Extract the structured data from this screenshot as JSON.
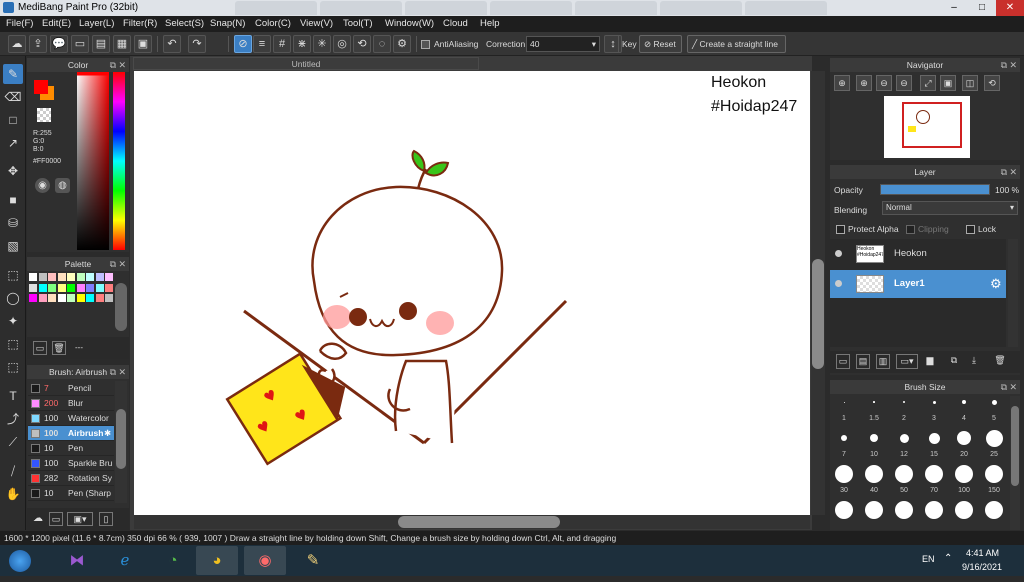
{
  "window": {
    "title": "MediBang Paint Pro (32bit)",
    "minimize": "–",
    "maximize": "□",
    "close": "✕"
  },
  "menu": [
    "File(F)",
    "Edit(E)",
    "Layer(L)",
    "Filter(R)",
    "Select(S)",
    "Snap(N)",
    "Color(C)",
    "View(V)",
    "Tool(T)",
    "Window(W)",
    "Cloud",
    "Help"
  ],
  "toolbar": {
    "antialiasing_label": "AntiAliasing",
    "correction_label": "Correction",
    "correction_value": "40",
    "key_label": "Key",
    "reset_label": "Reset",
    "straight_line_label": "Create a straight line"
  },
  "color_panel": {
    "title": "Color",
    "r_label": "R:255",
    "g_label": "G:0",
    "b_label": "B:0",
    "hex": "#FF0000",
    "foreground": "#ff0000",
    "background": "#ff8c00"
  },
  "palette_panel": {
    "title": "Palette",
    "colors": [
      "#ffffff",
      "#bfbfbf",
      "#ffbfbf",
      "#ffe0bf",
      "#ffffbf",
      "#bfffbf",
      "#bfffff",
      "#bfbfff",
      "#ffbfff",
      "#dfdfdf",
      "#00ffff",
      "#7fff7f",
      "#ffff7f",
      "#00ff00",
      "#ff7fff",
      "#7f7fff",
      "#7fffff",
      "#ff7f7f",
      "#ff00ff",
      "#ff9fbf",
      "#ffdfbf",
      "#ffffff",
      "#bfffbf",
      "#ffff00",
      "#00ffff",
      "#ff7f7f",
      "#bfbfbf"
    ],
    "dash": "---"
  },
  "brush_panel": {
    "title": "Brush: Airbrush",
    "items": [
      {
        "size": "7",
        "name": "Pencil",
        "color": "#1a1a1a"
      },
      {
        "size": "200",
        "name": "Blur",
        "color": "#ff8cff"
      },
      {
        "size": "100",
        "name": "Watercolor",
        "color": "#7fd9ff"
      },
      {
        "size": "100",
        "name": "Airbrush",
        "color": "#bfbfbf"
      },
      {
        "size": "10",
        "name": "Pen",
        "color": "#1a1a1a"
      },
      {
        "size": "100",
        "name": "Sparkle Bru",
        "color": "#3355ff"
      },
      {
        "size": "282",
        "name": "Rotation Sy",
        "color": "#ff3333"
      },
      {
        "size": "10",
        "name": "Pen (Sharp",
        "color": "#1a1a1a"
      }
    ],
    "selected_index": 3
  },
  "document": {
    "tab_title": "Untitled",
    "watermark_line1": "Heokon",
    "watermark_line2": "#Hoidap247"
  },
  "navigator": {
    "title": "Navigator"
  },
  "layer_panel": {
    "title": "Layer",
    "opacity_label": "Opacity",
    "opacity_value": "100 %",
    "opacity_fraction": 1.0,
    "blending_label": "Blending",
    "blending_value": "Normal",
    "protect_alpha": "Protect Alpha",
    "clipping": "Clipping",
    "lock": "Lock",
    "layers": [
      {
        "name": "Heokon",
        "thumb_text": "Heokon #Hoidap247",
        "selected": false
      },
      {
        "name": "Layer1",
        "selected": true
      }
    ]
  },
  "brush_size_panel": {
    "title": "Brush Size",
    "rows": [
      [
        "1",
        "1.5",
        "2",
        "3",
        "4",
        "5"
      ],
      [
        "7",
        "10",
        "12",
        "15",
        "20",
        "25"
      ],
      [
        "30",
        "40",
        "50",
        "70",
        "100",
        "150"
      ]
    ]
  },
  "status": {
    "text": "1600 * 1200 pixel   (11.6 * 8.7cm)   350 dpi   66 %   ( 939, 1007 )   Draw a straight line by holding down Shift, Change a brush size by holding down Ctrl, Alt, and dragging"
  },
  "taskbar": {
    "lang": "EN",
    "time": "4:41 AM",
    "date": "9/16/2021"
  },
  "colors": {
    "accent": "#3b7fc4",
    "panel": "#2f2f2f",
    "selected_layer": "#4a90d0"
  }
}
